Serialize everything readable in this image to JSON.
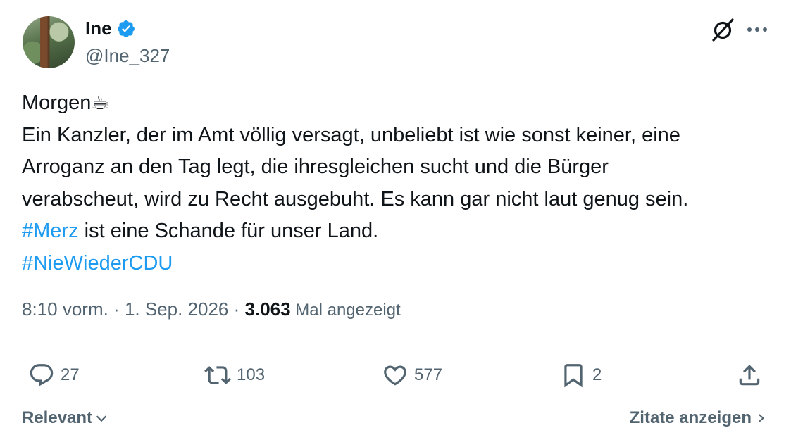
{
  "author": {
    "name": "Ine",
    "handle": "@Ine_327",
    "verified": true,
    "avatar": "avatar-photo-tree"
  },
  "tweet": {
    "lines": [
      "Morgen",
      "Ein Kanzler, der im Amt völlig versagt, unbeliebt ist wie sonst keiner, eine",
      "Arroganz an den Tag legt, die ihresgleichen sucht und die Bürger",
      "verabscheut, wird zu Recht ausgebuht. Es kann gar nicht laut genug sein."
    ],
    "emoji": "☕",
    "hashtag1": "#Merz",
    "line5_rest": " ist eine Schande für unser Land.",
    "hashtag2": "#NieWiederCDU"
  },
  "meta": {
    "time": "8:10 vorm.",
    "sep1": " · ",
    "date": "1. Sep. 2026",
    "sep2": " · ",
    "views_count": "3.063",
    "views_label": " Mal angezeigt"
  },
  "actions": {
    "replies": "27",
    "reposts": "103",
    "likes": "577",
    "bookmarks": "2"
  },
  "footer": {
    "sort_label": "Relevant",
    "quotes_label": "Zitate anzeigen"
  },
  "colors": {
    "accent": "#1d9bf0",
    "text": "#0f1419",
    "secondary": "#536471",
    "divider": "#eff3f4"
  },
  "icons": [
    "verified-badge-icon",
    "grok-icon",
    "more-icon",
    "reply-icon",
    "repost-icon",
    "like-icon",
    "bookmark-icon",
    "share-icon",
    "chevron-down-icon",
    "chevron-right-icon"
  ]
}
